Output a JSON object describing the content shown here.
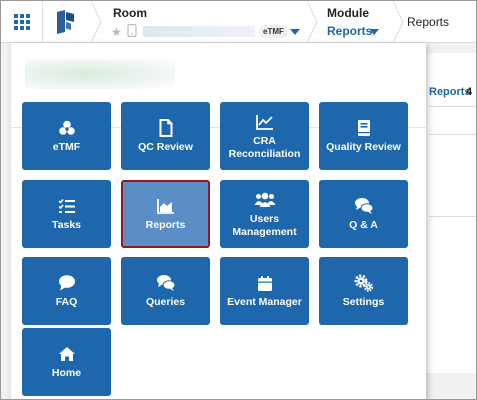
{
  "header": {
    "room_title": "Room",
    "room_badge": "eTMF",
    "module_title": "Module",
    "module_value": "Reports",
    "current_page": "Reports"
  },
  "background": {
    "reports_label": "Reports",
    "reports_count": "4"
  },
  "menu": {
    "tiles": [
      {
        "label": "eTMF",
        "icon": "biohazard-icon"
      },
      {
        "label": "QC Review",
        "icon": "document-icon"
      },
      {
        "label": "CRA Reconciliation",
        "icon": "line-chart-icon"
      },
      {
        "label": "Quality Review",
        "icon": "book-icon"
      },
      {
        "label": "Tasks",
        "icon": "task-list-icon"
      },
      {
        "label": "Reports",
        "icon": "area-chart-icon",
        "active": true
      },
      {
        "label": "Users Management",
        "icon": "users-icon"
      },
      {
        "label": "Q & A",
        "icon": "comments-icon"
      },
      {
        "label": "FAQ",
        "icon": "comment-icon"
      },
      {
        "label": "Queries",
        "icon": "comments-icon"
      },
      {
        "label": "Event Manager",
        "icon": "calendar-icon"
      },
      {
        "label": "Settings",
        "icon": "cogs-icon"
      },
      {
        "label": "Home",
        "icon": "home-icon"
      }
    ]
  },
  "colors": {
    "tile_bg": "#1f67ad",
    "tile_active_bg": "#5b8ec7",
    "tile_active_border": "#8a1b20",
    "link": "#2166a8"
  }
}
